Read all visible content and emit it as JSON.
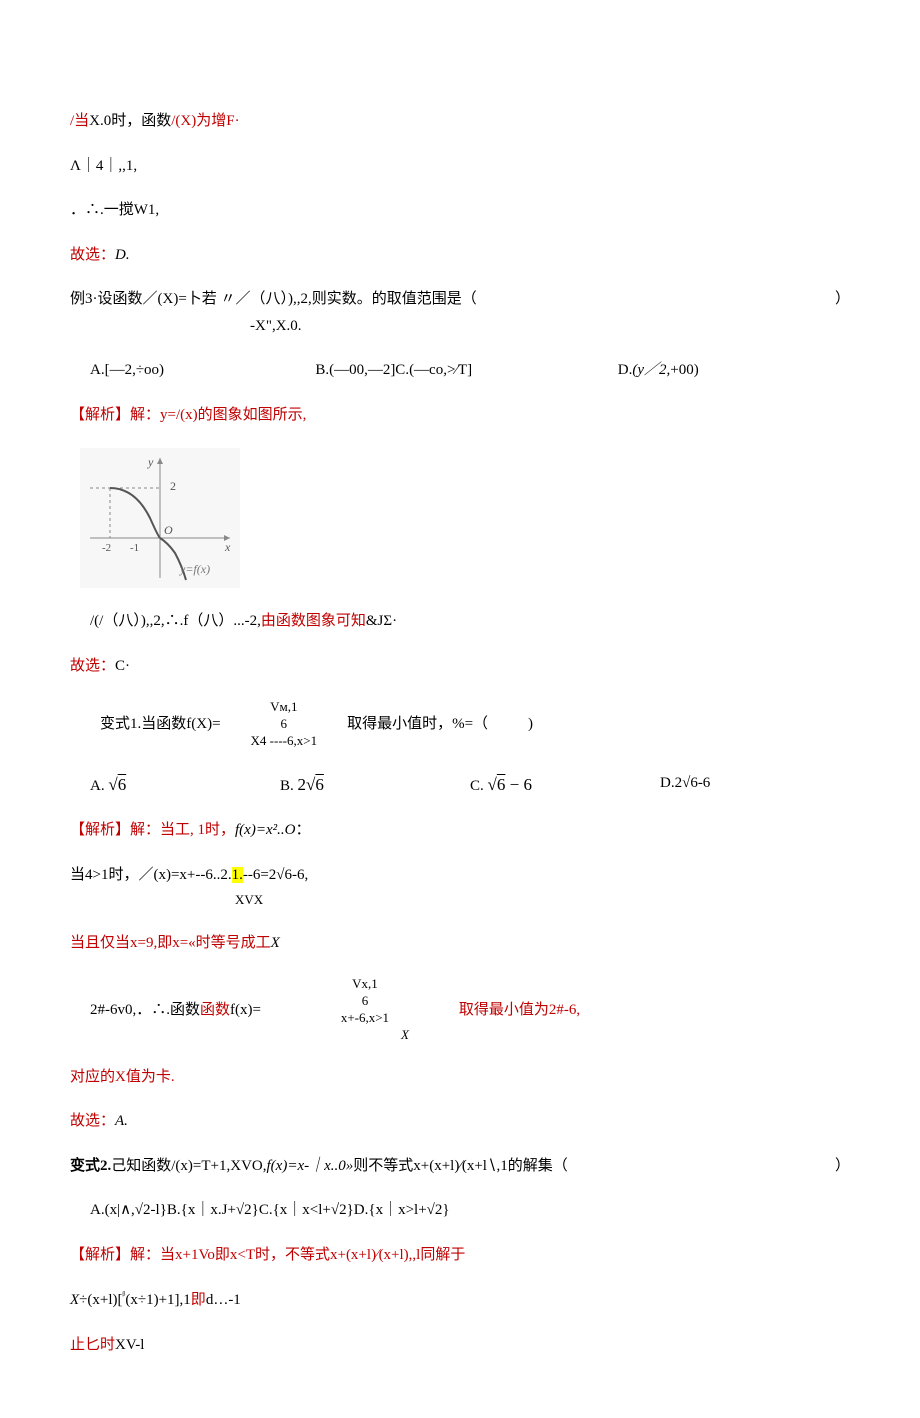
{
  "l1_pre": "/当",
  "l1_mid": "X.0时，函数",
  "l1_post": "/(X)为增F·",
  "l2": "Λ｜4｜,,1,",
  "l3": "．∴.一搅W1,",
  "l4_pre": "故选：",
  "l4_ans": "D.",
  "ex3_a": "例3·设函数／(X)=卜若 〃／（八）),,2,则实数。的取值范围是（",
  "ex3_b": "）",
  "ex3_sub": "-X\",X.0.",
  "ex3_optA": "A.[—2,÷oo)",
  "ex3_optB": "B.(—00,—2]C.(—co,>∕T]",
  "ex3_optD_pre": "D.",
  "ex3_optD_mid": "(y／2,",
  "ex3_optD_post": "+00)",
  "jx1_a": "【解析】解：y=",
  "jx1_b": "/(x)的图象如图所示,",
  "graph_labels": {
    "two": "2",
    "nTwo": "-2",
    "nOne": "-1",
    "O": "O",
    "x": "x",
    "y": "y",
    "yfx": "y=f(x)"
  },
  "g1_a": "/(/（八）),,2,∴.f（八）...-2,",
  "g1_b": "由函数图象可知",
  "g1_c": "&JΣ·",
  "gs1_a": "故选：",
  "gs1_b": "C·",
  "bs1_a": "变式1.当函数f(X)=",
  "bs1_p1": "Vᴍ,1",
  "bs1_p2": "6",
  "bs1_p3": "X4 ----6,x>1",
  "bs1_b": "取得最小值时，%=（",
  "bs1_c": ")",
  "bs1_optA_pre": "A.  ",
  "bs1_optA": "√6",
  "bs1_optB_pre": "B.  ",
  "bs1_optB": "2√6",
  "bs1_optC_pre": "C.  ",
  "bs1_optC": "√6 − 6",
  "bs1_optD": "D.2√6-6",
  "jx2_a": "【解析】解：当工, 1时，",
  "jx2_b": "f(x)=x²..O",
  "jx2_c": "：",
  "d4_a": "当4>1时，／(x)=x+--6..2.",
  "d4_hl": "1.",
  "d4_b": "--6=2√6-6,",
  "d4_sub": "XVX",
  "dd_a": "当且仅当x=9,即x=«时等号成工",
  "dd_b": "X",
  "qd_a": "2#-6v0,．∴.函数",
  "qd_b": "f(x)=",
  "qd_p1": "Vx,1",
  "qd_p2": "6",
  "qd_p3": "x+-6,x>1",
  "qd_p4": "X",
  "qd_c": "取得最小值为2#-6,",
  "dy_a": "对应的X值为卡.",
  "gs2_a": "故选：",
  "gs2_b": "A.",
  "bs2_bold": "变式2.",
  "bs2_a": "己知函数/(x)=T+1,XVO,",
  "bs2_b": "f(x)=x-｜x..0»",
  "bs2_c": "则不等式x+(x+l)∕(x+l∖,1的解集（",
  "bs2_d": "）",
  "bs2_opts": "A.(x|∧,√2-l}B.{x｜x.J+√2}C.{x｜x<l+√2}D.{x｜x>l+√2}",
  "jx3_a": "【解析】解：当x+1Vo即x<T时，不等式x+(x+l)∕(x+l),,l同解于",
  "xl": "X÷(x+l)[ᵝ(x÷1)+1],1即d…-1",
  "zc": "止匕时XV-l"
}
